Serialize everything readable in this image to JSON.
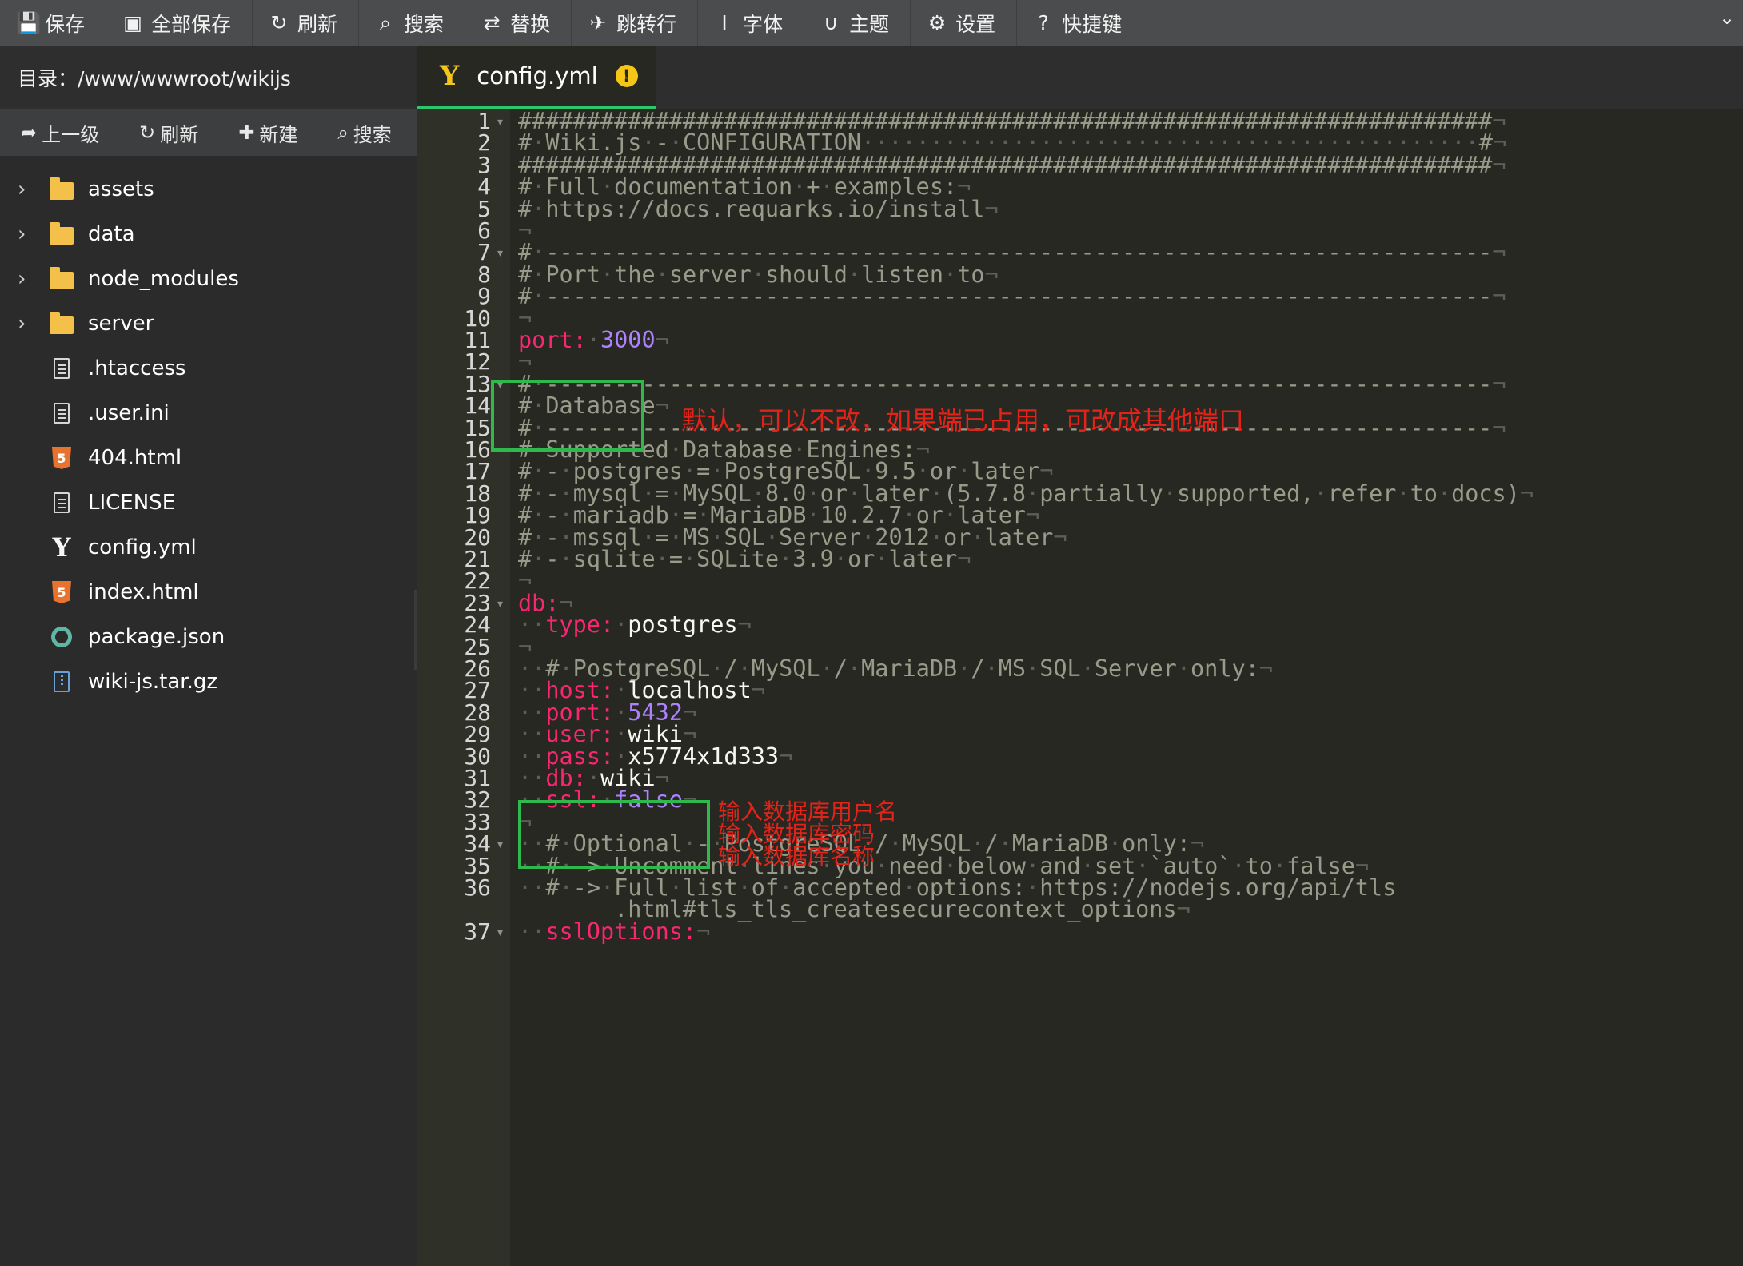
{
  "toolbar": {
    "buttons": [
      {
        "icon": "floppy-disk-icon",
        "glyph": "💾",
        "label": "保存"
      },
      {
        "icon": "save-all-icon",
        "glyph": "▣",
        "label": "全部保存"
      },
      {
        "icon": "refresh-icon",
        "glyph": "↻",
        "label": "刷新"
      },
      {
        "icon": "search-icon",
        "glyph": "⌕",
        "label": "搜索"
      },
      {
        "icon": "replace-icon",
        "glyph": "⇄",
        "label": "替换"
      },
      {
        "icon": "pin-icon",
        "glyph": "✈",
        "label": "跳转行"
      },
      {
        "icon": "text-icon",
        "glyph": "Ⅰ",
        "label": "字体"
      },
      {
        "icon": "theme-magnet-icon",
        "glyph": "∪",
        "label": "主题"
      },
      {
        "icon": "gear-icon",
        "glyph": "⚙",
        "label": "设置"
      },
      {
        "icon": "help-icon",
        "glyph": "?",
        "label": "快捷键"
      }
    ]
  },
  "sidebar": {
    "directory_label": "目录：/www/wwwroot/wikijs",
    "actions": [
      {
        "icon": "up-level-icon",
        "glyph": "➦",
        "label": "上一级"
      },
      {
        "icon": "refresh-icon",
        "glyph": "↻",
        "label": "刷新"
      },
      {
        "icon": "plus-icon",
        "glyph": "✚",
        "label": "新建"
      },
      {
        "icon": "search-icon",
        "glyph": "⌕",
        "label": "搜索"
      }
    ],
    "tree": [
      {
        "name": "assets",
        "type": "folder"
      },
      {
        "name": "data",
        "type": "folder"
      },
      {
        "name": "node_modules",
        "type": "folder"
      },
      {
        "name": "server",
        "type": "folder"
      },
      {
        "name": ".htaccess",
        "type": "doc"
      },
      {
        "name": ".user.ini",
        "type": "doc"
      },
      {
        "name": "404.html",
        "type": "html"
      },
      {
        "name": "LICENSE",
        "type": "doc"
      },
      {
        "name": "config.yml",
        "type": "yml"
      },
      {
        "name": "index.html",
        "type": "html"
      },
      {
        "name": "package.json",
        "type": "json"
      },
      {
        "name": "wiki-js.tar.gz",
        "type": "archive"
      }
    ]
  },
  "editor": {
    "tab": {
      "name": "config.yml",
      "status": "!"
    },
    "line_numbers": [
      "1",
      "2",
      "3",
      "4",
      "5",
      "6",
      "7",
      "8",
      "9",
      "10",
      "11",
      "12",
      "13",
      "14",
      "15",
      "16",
      "17",
      "18",
      "19",
      "20",
      "21",
      "22",
      "23",
      "24",
      "25",
      "26",
      "27",
      "28",
      "29",
      "30",
      "31",
      "32",
      "33",
      "34",
      "35",
      "36",
      "",
      "37"
    ],
    "lines": [
      "#######################################################################¬",
      "#·Wiki.js·-·CONFIGURATION·············································#¬",
      "#######################################################################¬",
      "#·Full·documentation·+·examples:¬",
      "#·https://docs.requarks.io/install¬",
      "¬",
      "#·---------------------------------------------------------------------¬",
      "#·Port·the·server·should·listen·to¬",
      "#·---------------------------------------------------------------------¬",
      "¬",
      "port:·3000¬",
      "¬",
      "#·---------------------------------------------------------------------¬",
      "#·Database¬",
      "#·---------------------------------------------------------------------¬",
      "#·Supported·Database·Engines:¬",
      "#·-·postgres·=·PostgreSQL·9.5·or·later¬",
      "#·-·mysql·=·MySQL·8.0·or·later·(5.7.8·partially·supported,·refer·to·docs)¬",
      "#·-·mariadb·=·MariaDB·10.2.7·or·later¬",
      "#·-·mssql·=·MS·SQL·Server·2012·or·later¬",
      "#·-·sqlite·=·SQLite·3.9·or·later¬",
      "¬",
      "db:¬",
      "··type:·postgres¬",
      "¬",
      "··#·PostgreSQL·/·MySQL·/·MariaDB·/·MS·SQL·Server·only:¬",
      "··host:·localhost¬",
      "··port:·5432¬",
      "··user:·wiki¬",
      "··pass:·x5774x1d333¬",
      "··db:·wiki¬",
      "··ssl:·false¬",
      "¬",
      "··#·Optional·-·PostgreSQL·/·MySQL·/·MariaDB·only:¬",
      "··#·->·Uncomment·lines·you·need·below·and·set·`auto`·to·false¬",
      "··#·->·Full·list·of·accepted·options:·https://nodejs.org/api/tls",
      "       .html#tls_tls_createsecurecontext_options¬",
      "··sslOptions:¬"
    ],
    "annotations": {
      "port_note": "默认，可以不改，如果端已占用，可改成其他端口",
      "user_note": "输入数据库用户名",
      "pass_note": "输入数据库密码",
      "db_note": "输入数据库名称"
    }
  },
  "colors": {
    "accent_green": "#2cc66b",
    "annotation_red": "#e2231a",
    "yaml_key": "#f92672",
    "yaml_number": "#ae81ff",
    "warning_yellow": "#f5c518"
  }
}
